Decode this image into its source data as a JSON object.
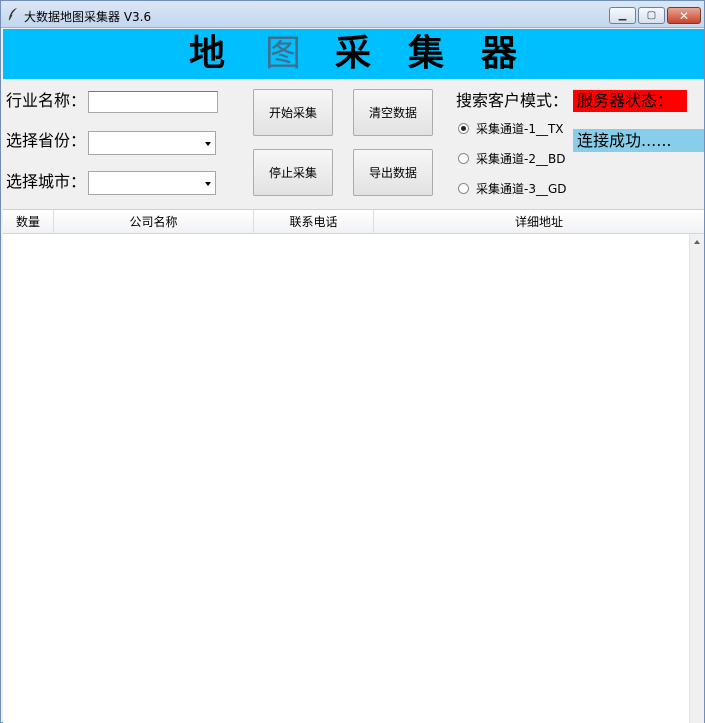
{
  "window": {
    "title": "大数据地图采集器 V3.6"
  },
  "banner": {
    "chars": [
      "地",
      "图",
      "采",
      "集",
      "器"
    ]
  },
  "form": {
    "industry_label": "行业名称：",
    "industry_value": "",
    "province_label": "选择省份：",
    "province_value": "",
    "city_label": "选择城市：",
    "city_value": ""
  },
  "buttons": {
    "start": "开始采集",
    "clear": "清空数据",
    "stop": "停止采集",
    "export": "导出数据"
  },
  "mode": {
    "label": "搜索客户模式：",
    "options": [
      "采集通道-1__TX",
      "采集通道-2__BD",
      "采集通道-3__GD"
    ],
    "selected": 0
  },
  "server": {
    "status_label": "服务器状态：",
    "status_text": "连接成功......",
    "label_color": "#ff0000",
    "status_color": "#87ceeb"
  },
  "table": {
    "columns": [
      "数量",
      "公司名称",
      "联系电话",
      "详细地址"
    ],
    "rows": []
  },
  "colors": {
    "banner": "#00bfff"
  }
}
